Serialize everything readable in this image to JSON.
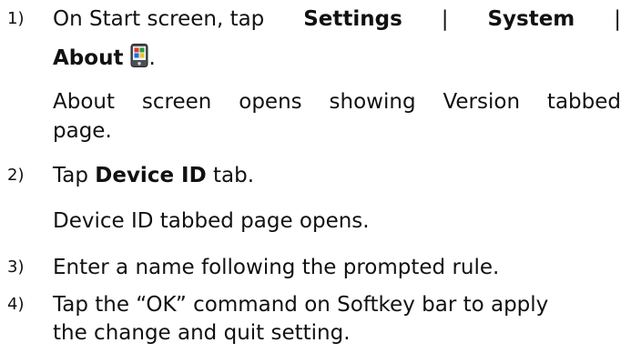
{
  "steps": [
    {
      "number": "1)",
      "line1": {
        "prefix": "On Start screen, tap",
        "settings": "Settings",
        "sep1": "|",
        "system": "System",
        "sep2": "|"
      },
      "line2": {
        "about": "About",
        "period": "."
      },
      "icon": "windows-mobile-device-icon",
      "result_line1": {
        "w1": "About",
        "w2": "screen",
        "w3": "opens",
        "w4": "showing",
        "w5": "Version",
        "w6": "tabbed"
      },
      "result_line2": "page."
    },
    {
      "number": "2)",
      "prefix": "Tap",
      "bold": "Device ID",
      "suffix": "tab.",
      "result": "Device ID tabbed page opens."
    },
    {
      "number": "3)",
      "text": "Enter a name following the prompted rule."
    },
    {
      "number": "4)",
      "line1": "Tap the “OK” command on Softkey bar to apply",
      "line2": "the change and quit setting."
    }
  ]
}
